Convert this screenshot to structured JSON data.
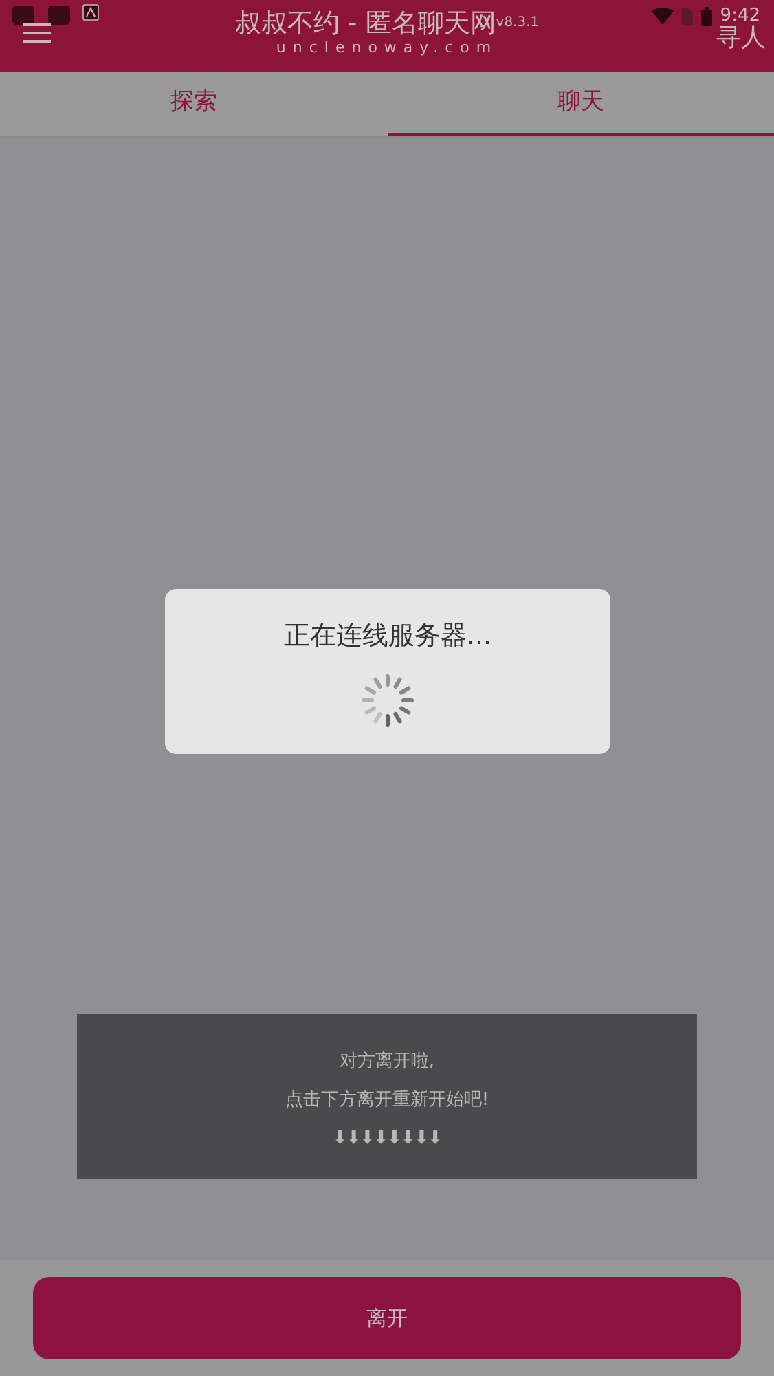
{
  "status_bar": {
    "time": "9:42"
  },
  "header": {
    "title": "叔叔不约 - 匿名聊天网",
    "version": "v8.3.1",
    "subtitle": "unclenoway.com",
    "action": "寻人"
  },
  "tabs": [
    {
      "label": "探索",
      "selected": false
    },
    {
      "label": "聊天",
      "selected": true
    }
  ],
  "dialog": {
    "message": "正在连线服务器..."
  },
  "notice": {
    "lines": [
      "对方离开啦,",
      "点击下方离开重新开始吧!"
    ],
    "arrows": "⬇⬇⬇⬇⬇⬇⬇⬇"
  },
  "leave_button": "离开"
}
